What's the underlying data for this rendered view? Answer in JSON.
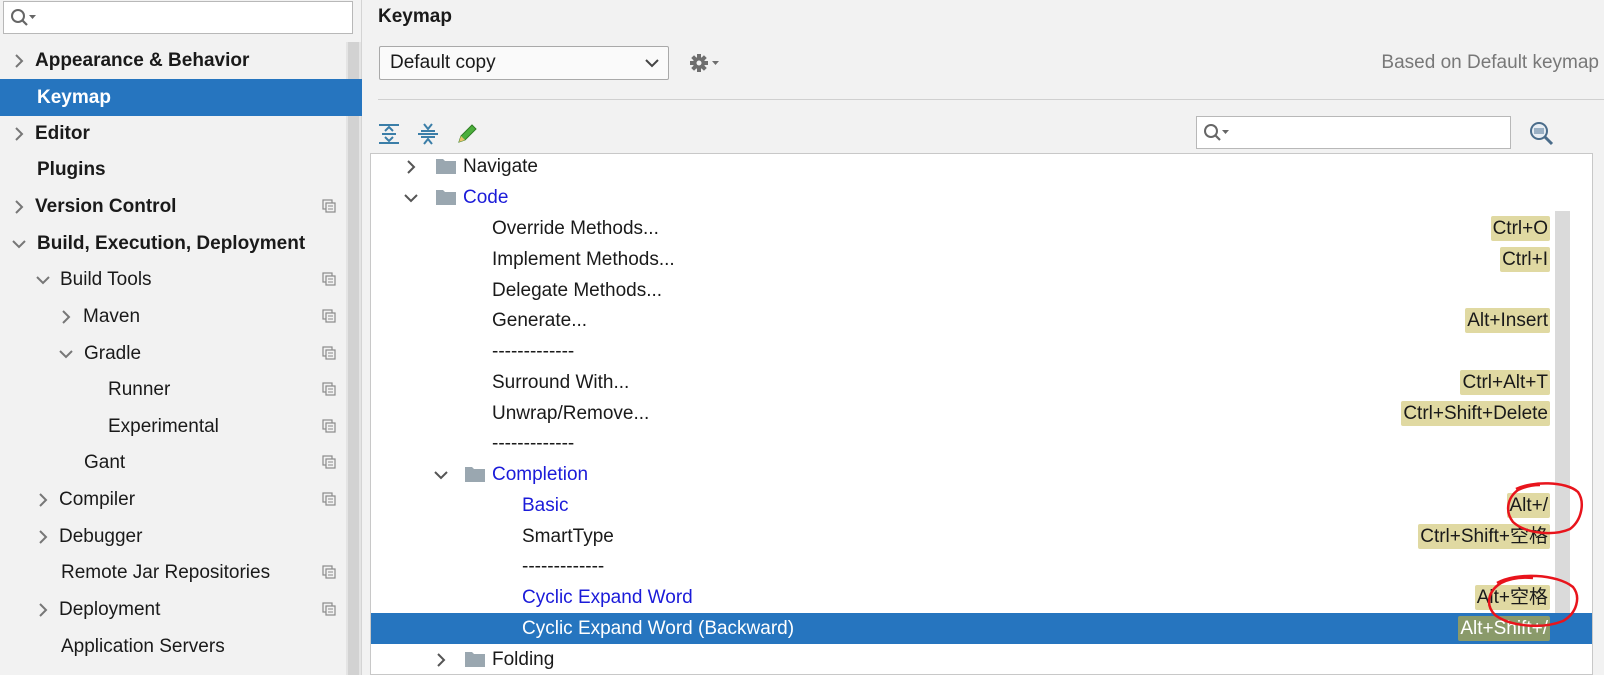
{
  "left_panel": {
    "search": {
      "value": "",
      "placeholder": ""
    },
    "items": [
      {
        "label": "Appearance & Behavior",
        "expanded": false
      },
      {
        "label": "Keymap",
        "selected": true
      },
      {
        "label": "Editor",
        "expanded": false
      },
      {
        "label": "Plugins"
      },
      {
        "label": "Version Control",
        "expanded": false
      },
      {
        "label": "Build, Execution, Deployment",
        "expanded": true
      },
      {
        "label": "Build Tools",
        "expanded": true
      },
      {
        "label": "Maven",
        "expanded": false
      },
      {
        "label": "Gradle",
        "expanded": true
      },
      {
        "label": "Runner"
      },
      {
        "label": "Experimental"
      },
      {
        "label": "Gant"
      },
      {
        "label": "Compiler",
        "expanded": false
      },
      {
        "label": "Debugger",
        "expanded": false
      },
      {
        "label": "Remote Jar Repositories"
      },
      {
        "label": "Deployment",
        "expanded": false
      },
      {
        "label": "Application Servers"
      }
    ]
  },
  "keymap": {
    "title": "Keymap",
    "selected_keymap": "Default copy",
    "based_on": "Based on Default keymap",
    "action_search": {
      "value": "",
      "placeholder": ""
    },
    "tree": [
      {
        "label": "Navigate",
        "type": "folder",
        "expanded": false,
        "shortcut": ""
      },
      {
        "label": "Code",
        "type": "folder",
        "expanded": true,
        "shortcut": ""
      },
      {
        "label": "Override Methods...",
        "shortcut": "Ctrl+O"
      },
      {
        "label": "Implement Methods...",
        "shortcut": "Ctrl+I"
      },
      {
        "label": "Delegate Methods...",
        "shortcut": ""
      },
      {
        "label": "Generate...",
        "shortcut": "Alt+Insert"
      },
      {
        "label": "-------------",
        "shortcut": ""
      },
      {
        "label": "Surround With...",
        "shortcut": "Ctrl+Alt+T"
      },
      {
        "label": "Unwrap/Remove...",
        "shortcut": "Ctrl+Shift+Delete"
      },
      {
        "label": "-------------",
        "shortcut": ""
      },
      {
        "label": "Completion",
        "type": "folder",
        "expanded": true,
        "shortcut": ""
      },
      {
        "label": "Basic",
        "shortcut": "Alt+/"
      },
      {
        "label": "SmartType",
        "shortcut": "Ctrl+Shift+空格"
      },
      {
        "label": "-------------",
        "shortcut": ""
      },
      {
        "label": "Cyclic Expand Word",
        "shortcut": "Alt+空格"
      },
      {
        "label": "Cyclic Expand Word (Backward)",
        "shortcut": "Alt+Shift+/",
        "selected": true
      },
      {
        "label": "Folding",
        "type": "folder",
        "expanded": false,
        "shortcut": ""
      }
    ]
  },
  "colors": {
    "selection": "#2675bf",
    "modified_text": "#1b1bd9",
    "shortcut_bg": "#e0d9a2",
    "annotation": "#e8141c"
  }
}
